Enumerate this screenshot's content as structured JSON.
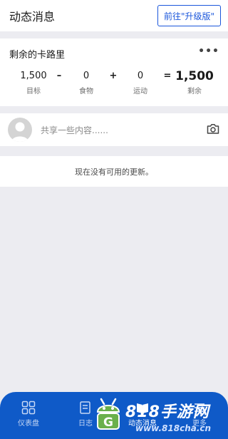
{
  "header": {
    "title": "动态消息",
    "upgrade_label": "前往\"升级版\""
  },
  "calories": {
    "title": "剩余的卡路里",
    "more_icon": "more-horizontal-icon",
    "goal": {
      "value": "1,500",
      "label": "目标"
    },
    "op_minus": "–",
    "food": {
      "value": "0",
      "label": "食物"
    },
    "op_plus": "+",
    "exercise": {
      "value": "0",
      "label": "运动"
    },
    "op_equals": "=",
    "remaining": {
      "value": "1,500",
      "label": "剩余"
    }
  },
  "share": {
    "placeholder": "共享一些内容......",
    "avatar_icon": "default-avatar-icon",
    "camera_icon": "camera-icon"
  },
  "feed": {
    "empty_text": "现在没有可用的更新。"
  },
  "tabbar": {
    "tabs": [
      {
        "label": "仪表盘",
        "icon": "dashboard-grid-icon"
      },
      {
        "label": "日志",
        "icon": "diary-icon"
      },
      {
        "label": "动态消息",
        "icon": "news-feed-icon",
        "active": true
      },
      {
        "label": "更多",
        "icon": "menu-icon"
      }
    ]
  },
  "watermark": {
    "title": "818手游网",
    "url": "www.818cha.cn"
  },
  "colors": {
    "brand_blue": "#0f5ac8",
    "accent_blue": "#1a56db",
    "background": "#ececf1"
  }
}
